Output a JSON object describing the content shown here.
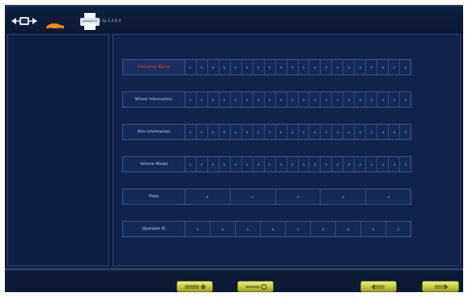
{
  "header": {
    "version": "7830 2p 5.2.6.4",
    "icons": [
      "wheel-alignment-icon",
      "car-icon",
      "printer-icon"
    ]
  },
  "colors": {
    "background": "#0e1d3c",
    "panel": "#10234b",
    "row_border": "#3c5584",
    "active_label": "#e23b3b",
    "button": "#d0d84f"
  },
  "form": {
    "rows": [
      {
        "label": "Customer Name",
        "active": true,
        "cells": 20
      },
      {
        "label": "Wheel Information",
        "active": false,
        "cells": 20
      },
      {
        "label": "Rim Information",
        "active": false,
        "cells": 20
      },
      {
        "label": "Vehicle Model",
        "active": false,
        "cells": 20
      },
      {
        "label": "Plate",
        "active": false,
        "cells": 5
      },
      {
        "label": "Operator ID",
        "active": false,
        "cells": 9
      }
    ]
  },
  "footer": {
    "buttons": [
      "keyboard-button",
      "tools-button",
      "back-button",
      "forward-button"
    ]
  }
}
